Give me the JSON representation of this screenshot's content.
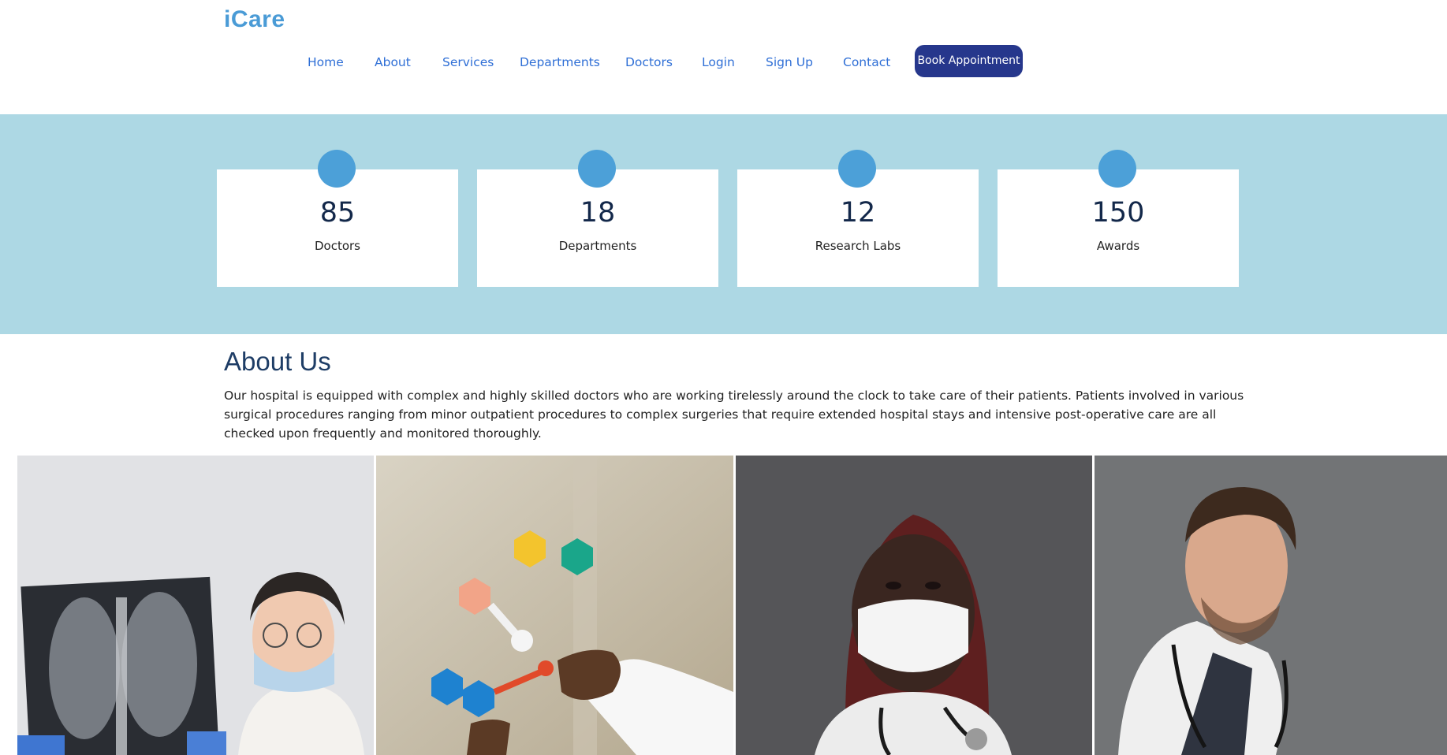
{
  "brand": "iCare",
  "nav": {
    "items": [
      "Home",
      "About",
      "Services",
      "Departments",
      "Doctors",
      "Login",
      "Sign Up",
      "Contact"
    ],
    "cta": "Book Appointment"
  },
  "stats": [
    {
      "value": "85",
      "label": "Doctors"
    },
    {
      "value": "18",
      "label": "Departments"
    },
    {
      "value": "12",
      "label": "Research Labs"
    },
    {
      "value": "150",
      "label": "Awards"
    }
  ],
  "about": {
    "title": "About Us",
    "text": "Our hospital is equipped with complex and highly skilled doctors who are working tirelessly around the clock to take care of their patients. Patients involved in various surgical procedures ranging from minor outpatient procedures to complex surgeries that require extended hospital stays and intensive post-operative care are all checked upon frequently and monitored thoroughly."
  },
  "colors": {
    "brand": "#4a9bd6",
    "nav_link": "#2f6fd6",
    "cta_bg": "#26378c",
    "stats_bg": "#add8e4",
    "stat_dot": "#4ca0d8"
  },
  "gallery": [
    {
      "icon": "doctor-xray-photo"
    },
    {
      "icon": "molecule-model-photo"
    },
    {
      "icon": "masked-doctor-photo"
    },
    {
      "icon": "doctor-stethoscope-photo"
    }
  ]
}
